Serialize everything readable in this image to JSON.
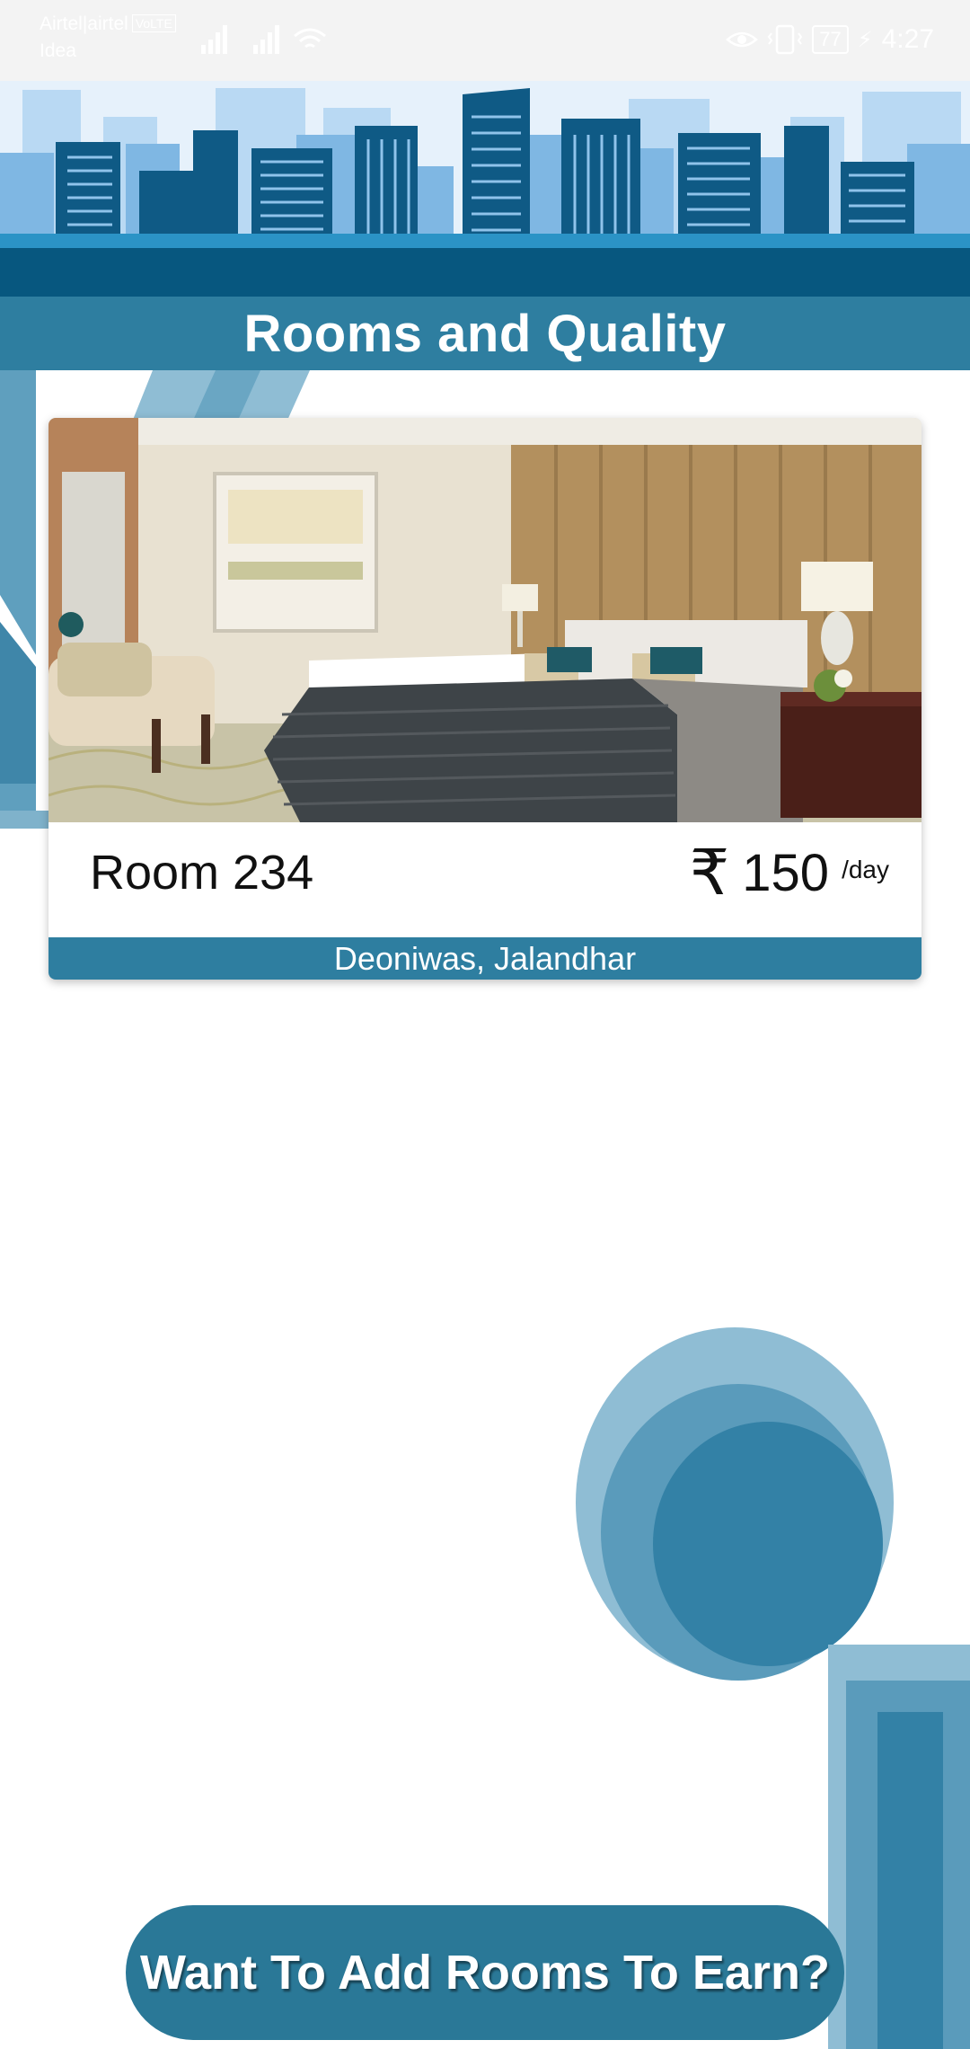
{
  "status_bar": {
    "carrier_primary": "Airtel|airtel",
    "lte_badge": "VoLTE",
    "carrier_secondary": "Idea",
    "battery": "77",
    "time": "4:27",
    "eye_icon": "eye-icon",
    "vibrate_icon": "vibrate-icon",
    "charging_icon": "bolt-icon"
  },
  "header": {
    "title": "Rooms and Quality",
    "illustration": "city-skyline"
  },
  "room_card": {
    "name": "Room 234",
    "currency_symbol": "₹",
    "price": "150",
    "price_unit": "/day",
    "location": "Deoniwas, Jalandhar"
  },
  "cta": {
    "label": "Want To Add Rooms To Earn?"
  },
  "colors": {
    "primary": "#2e7ea0",
    "dark_blue": "#0f5a85",
    "light_blue": "#b7d8f2",
    "background": "#ffffff"
  }
}
